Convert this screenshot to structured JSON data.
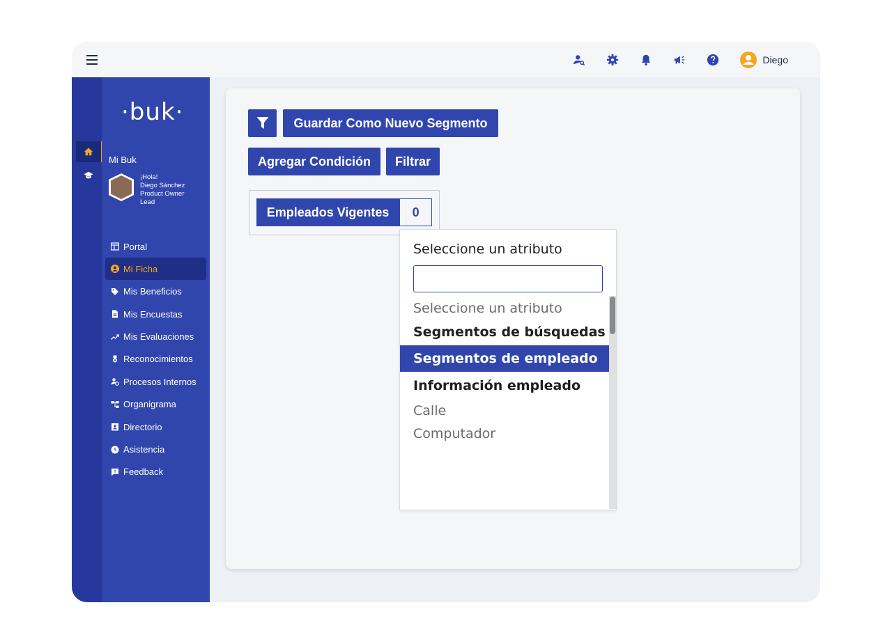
{
  "topbar": {
    "menu_icon": "hamburger-icon",
    "icons": [
      "user-search-icon",
      "gear-icon",
      "bell-icon",
      "megaphone-icon",
      "help-icon"
    ],
    "user_name": "Diego"
  },
  "rail": {
    "items": [
      "home-icon",
      "graduation-cap-icon"
    ]
  },
  "sidebar": {
    "logo": "·buk·",
    "section_title": "Mi Buk",
    "profile": {
      "greeting": "¡Hola!",
      "name": "Diego Sánchez",
      "role_line1": "Product Owner",
      "role_line2": "Lead"
    },
    "items": [
      {
        "label": "Portal",
        "icon": "dashboard-icon"
      },
      {
        "label": "Mi Ficha",
        "icon": "user-circle-icon"
      },
      {
        "label": "Mis Beneficios",
        "icon": "tag-icon"
      },
      {
        "label": "Mis Encuestas",
        "icon": "document-icon"
      },
      {
        "label": "Mis Evaluaciones",
        "icon": "trending-icon"
      },
      {
        "label": "Reconocimientos",
        "icon": "medal-icon"
      },
      {
        "label": "Procesos Internos",
        "icon": "people-gear-icon"
      },
      {
        "label": "Organigrama",
        "icon": "org-chart-icon"
      },
      {
        "label": "Directorio",
        "icon": "contact-book-icon"
      },
      {
        "label": "Asistencia",
        "icon": "clock-icon"
      },
      {
        "label": "Feedback",
        "icon": "feedback-icon"
      }
    ],
    "active_item": "Mi Ficha"
  },
  "main": {
    "filter_button_icon": "filter-icon",
    "save_segment_label": "Guardar Como Nuevo Segmento",
    "add_condition_label": "Agregar Condición",
    "filter_label": "Filtrar",
    "segment": {
      "name": "Empleados Vigentes",
      "count": "0"
    }
  },
  "dropdown": {
    "title": "Seleccione un atributo",
    "search_value": "",
    "options": [
      {
        "label": "Seleccione un atributo",
        "kind": "option"
      },
      {
        "label": "Segmentos de búsquedas",
        "kind": "group"
      },
      {
        "label": "Segmentos de empleado",
        "kind": "selected"
      },
      {
        "label": "Información empleado",
        "kind": "group"
      },
      {
        "label": "Calle",
        "kind": "option"
      },
      {
        "label": "Computador",
        "kind": "option"
      }
    ]
  },
  "colors": {
    "brand_blue": "#3046ad",
    "rail_blue": "#26389b",
    "accent_orange": "#f5a623",
    "icon_blue": "#2d45b0"
  }
}
